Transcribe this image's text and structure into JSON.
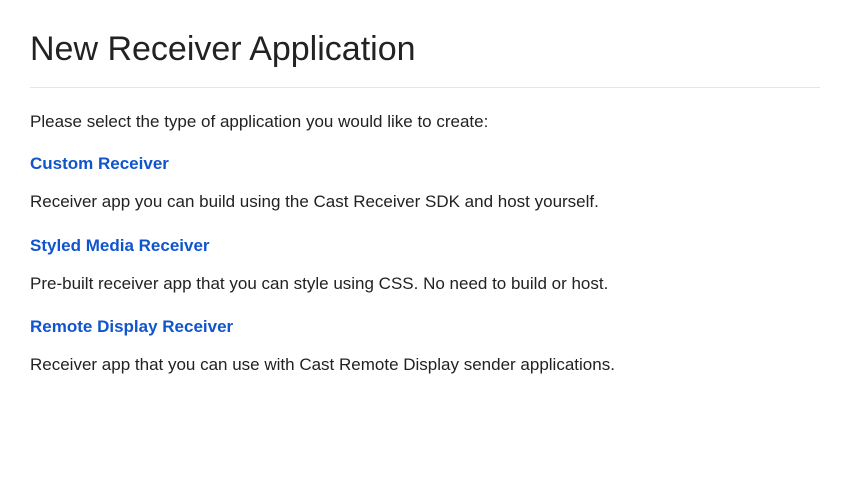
{
  "title": "New Receiver Application",
  "intro": "Please select the type of application you would like to create:",
  "options": [
    {
      "label": "Custom Receiver",
      "description": "Receiver app you can build using the Cast Receiver SDK and host yourself."
    },
    {
      "label": "Styled Media Receiver",
      "description": "Pre-built receiver app that you can style using CSS. No need to build or host."
    },
    {
      "label": "Remote Display Receiver",
      "description": "Receiver app that you can use with Cast Remote Display sender applications."
    }
  ]
}
